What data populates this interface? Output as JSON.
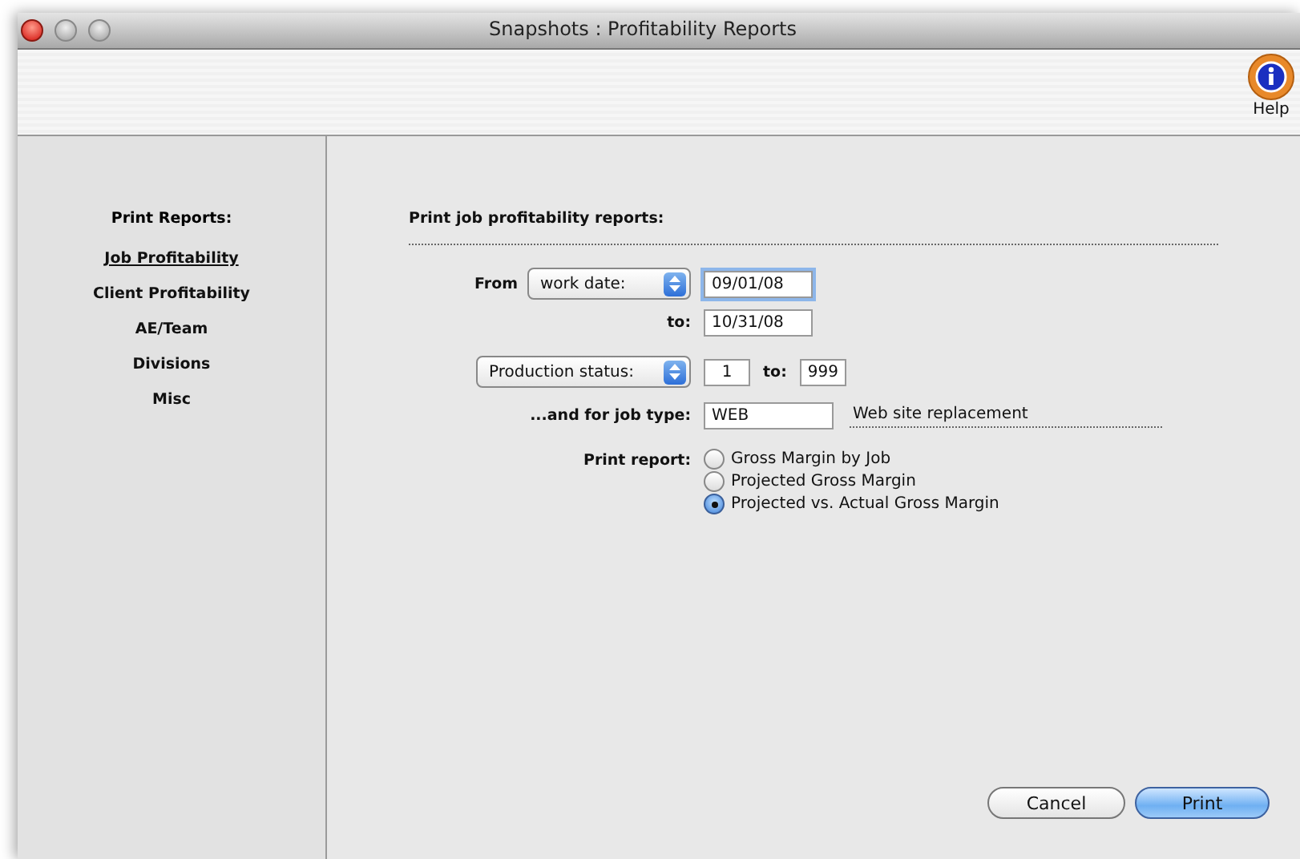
{
  "window": {
    "title": "Snapshots : Profitability Reports"
  },
  "toolbar": {
    "help_label": "Help"
  },
  "sidebar": {
    "heading": "Print Reports:",
    "items": [
      {
        "label": "Job Profitability",
        "selected": true
      },
      {
        "label": "Client Profitability",
        "selected": false
      },
      {
        "label": "AE/Team",
        "selected": false
      },
      {
        "label": "Divisions",
        "selected": false
      },
      {
        "label": "Misc",
        "selected": false
      }
    ]
  },
  "form": {
    "heading": "Print job profitability reports:",
    "from_label": "From",
    "date_popup": "work date:",
    "date_from": "09/01/08",
    "date_from_focused": true,
    "to_label": "to:",
    "date_to": "10/31/08",
    "status_popup": "Production status:",
    "status_from": "1",
    "status_to_label": "to:",
    "status_to": "999",
    "job_type_label": "...and for job type:",
    "job_type": "WEB",
    "job_type_description": "Web site replacement",
    "report_label": "Print report:",
    "reports": [
      {
        "label": "Gross Margin by Job",
        "selected": false
      },
      {
        "label": "Projected Gross Margin",
        "selected": false
      },
      {
        "label": "Projected vs. Actual Gross Margin",
        "selected": true
      }
    ]
  },
  "buttons": [
    {
      "label": "Cancel",
      "kind": "secondary"
    },
    {
      "label": "Print",
      "kind": "default"
    }
  ]
}
